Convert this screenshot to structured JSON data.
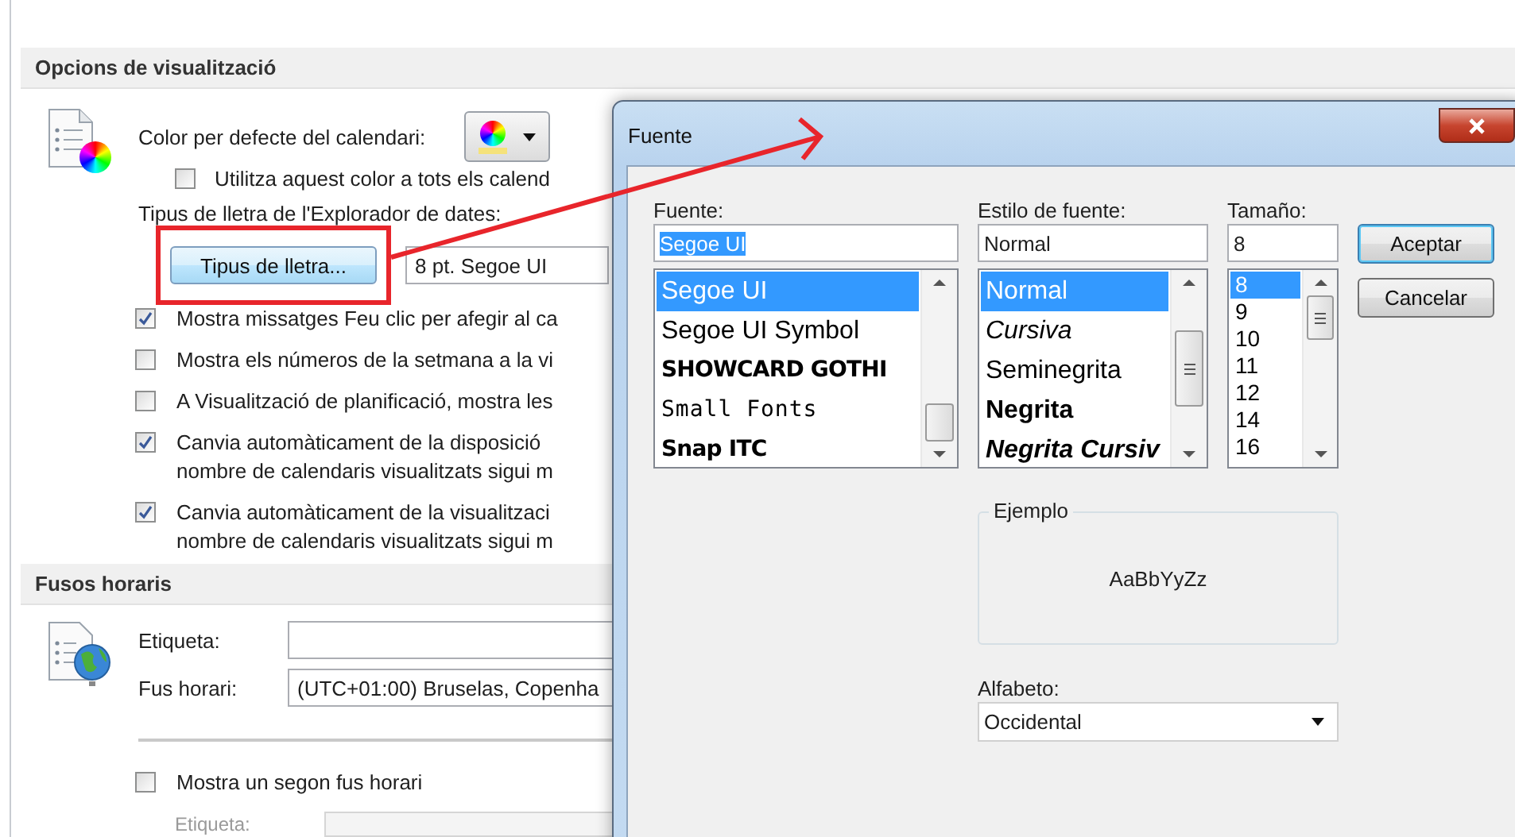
{
  "options_page": {
    "display_section": {
      "title": "Opcions de visualització",
      "color_label": "Color per defecte del calendari:",
      "use_color_checkbox": {
        "label": "Utilitza aquest color a tots els calend",
        "checked": false
      },
      "font_label": "Tipus de lletra de l'Explorador de dates:",
      "font_button": "Tipus de lletra...",
      "font_value": "8 pt. Segoe UI",
      "options": [
        {
          "lines": [
            "Mostra missatges Feu clic per afegir al ca"
          ],
          "checked": true
        },
        {
          "lines": [
            "Mostra els números de la setmana a la vi"
          ],
          "checked": false
        },
        {
          "lines": [
            "A Visualització de planificació, mostra les"
          ],
          "checked": false
        },
        {
          "lines": [
            "Canvia automàticament de la disposició",
            "nombre de calendaris visualitzats sigui m"
          ],
          "checked": true
        },
        {
          "lines": [
            "Canvia automàticament de la visualitzaci",
            "nombre de calendaris visualitzats sigui m"
          ],
          "checked": true
        }
      ]
    },
    "timezone_section": {
      "title": "Fusos horaris",
      "label_field": {
        "label": "Etiqueta:"
      },
      "timezone_field": {
        "label": "Fus horari:",
        "value": "(UTC+01:00) Bruselas, Copenha"
      },
      "second_timezone": {
        "label": "Mostra un segon fus horari",
        "checked": false
      },
      "second_label_field": {
        "label": "Etiqueta:",
        "disabled": true
      }
    }
  },
  "font_dialog": {
    "title": "Fuente",
    "font": {
      "label": "Fuente:",
      "value": "Segoe UI",
      "value_selected": true,
      "items": [
        {
          "text": "Segoe UI",
          "selected": true,
          "kind": "regular"
        },
        {
          "text": "Segoe UI Symbol",
          "selected": false,
          "kind": "regular"
        },
        {
          "text": "SHOWCARD GOTHI",
          "selected": false,
          "kind": "display"
        },
        {
          "text": "Small Fonts",
          "selected": false,
          "kind": "pixel"
        },
        {
          "text": "Snap ITC",
          "selected": false,
          "kind": "display"
        }
      ]
    },
    "style": {
      "label": "Estilo de fuente:",
      "value": "Normal",
      "value_selected": false,
      "items": [
        {
          "text": "Normal",
          "selected": true,
          "kind": "regular"
        },
        {
          "text": "Cursiva",
          "selected": false,
          "kind": "italic"
        },
        {
          "text": "Seminegrita",
          "selected": false,
          "kind": "regular"
        },
        {
          "text": "Negrita",
          "selected": false,
          "kind": "bold"
        },
        {
          "text": "Negrita Cursiv",
          "selected": false,
          "kind": "bold-italic"
        }
      ]
    },
    "size": {
      "label": "Tamaño:",
      "value": "8",
      "value_selected": false,
      "items": [
        {
          "text": "8",
          "selected": true
        },
        {
          "text": "9",
          "selected": false
        },
        {
          "text": "10",
          "selected": false
        },
        {
          "text": "11",
          "selected": false
        },
        {
          "text": "12",
          "selected": false
        },
        {
          "text": "14",
          "selected": false
        },
        {
          "text": "16",
          "selected": false
        }
      ]
    },
    "buttons": [
      {
        "label": "Aceptar",
        "default": true
      },
      {
        "label": "Cancelar",
        "default": false
      }
    ],
    "sample": {
      "title": "Ejemplo",
      "text": "AaBbYyZz"
    },
    "script": {
      "label": "Alfabeto:",
      "value": "Occidental"
    }
  }
}
